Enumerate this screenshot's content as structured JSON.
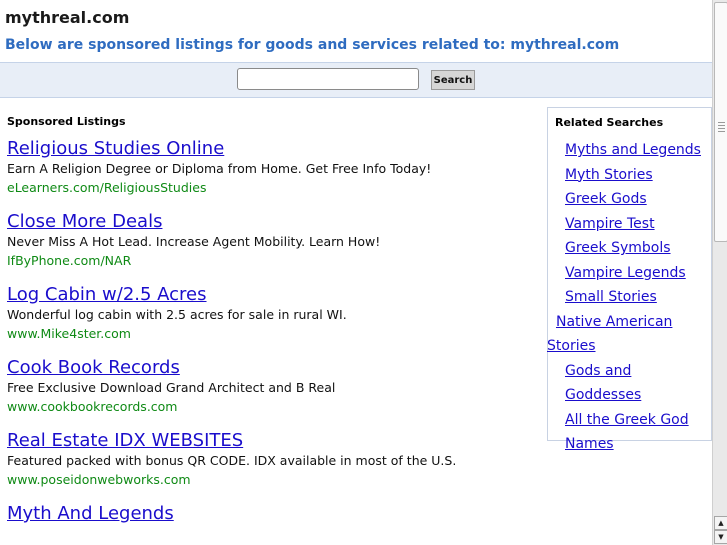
{
  "header": {
    "title": "mythreal.com",
    "subtitle": "Below are sponsored listings for goods and services related to: mythreal.com"
  },
  "search": {
    "value": "",
    "placeholder": "",
    "button_label": "Search"
  },
  "main": {
    "section_heading": "Sponsored Listings",
    "listings": [
      {
        "title": "Religious Studies Online",
        "desc": "Earn A Religion Degree or Diploma from Home. Get Free Info Today!",
        "url": "eLearners.com/ReligiousStudies"
      },
      {
        "title": "Close More Deals",
        "desc": "Never Miss A Hot Lead. Increase Agent Mobility. Learn How!",
        "url": "IfByPhone.com/NAR"
      },
      {
        "title": "Log Cabin w/2.5 Acres",
        "desc": "Wonderful log cabin with 2.5 acres for sale in rural WI.",
        "url": "www.Mike4ster.com"
      },
      {
        "title": "Cook Book Records",
        "desc": "Free Exclusive Download Grand Architect and B Real",
        "url": "www.cookbookrecords.com"
      },
      {
        "title": "Real Estate IDX WEBSITES",
        "desc": "Featured packed with bonus QR CODE. IDX available in most of the U.S.",
        "url": "www.poseidonwebworks.com"
      },
      {
        "title": "Myth And Legends",
        "desc": "",
        "url": ""
      }
    ]
  },
  "related": {
    "heading": "Related Searches",
    "items": [
      "Myths and Legends",
      "Myth Stories",
      "Greek Gods",
      "Vampire Test",
      "Greek Symbols",
      "Vampire Legends",
      "Small Stories",
      "Native American Stories",
      "Gods and Goddesses",
      "All the Greek God Names"
    ]
  },
  "colors": {
    "link": "#1a0dcc",
    "url_green": "#0f8a15",
    "subtitle_blue": "#2f6cc0",
    "search_bar_bg": "#e8eef7"
  },
  "icons": {
    "scroll_up": "up-arrow-icon",
    "scroll_down": "down-arrow-icon"
  }
}
